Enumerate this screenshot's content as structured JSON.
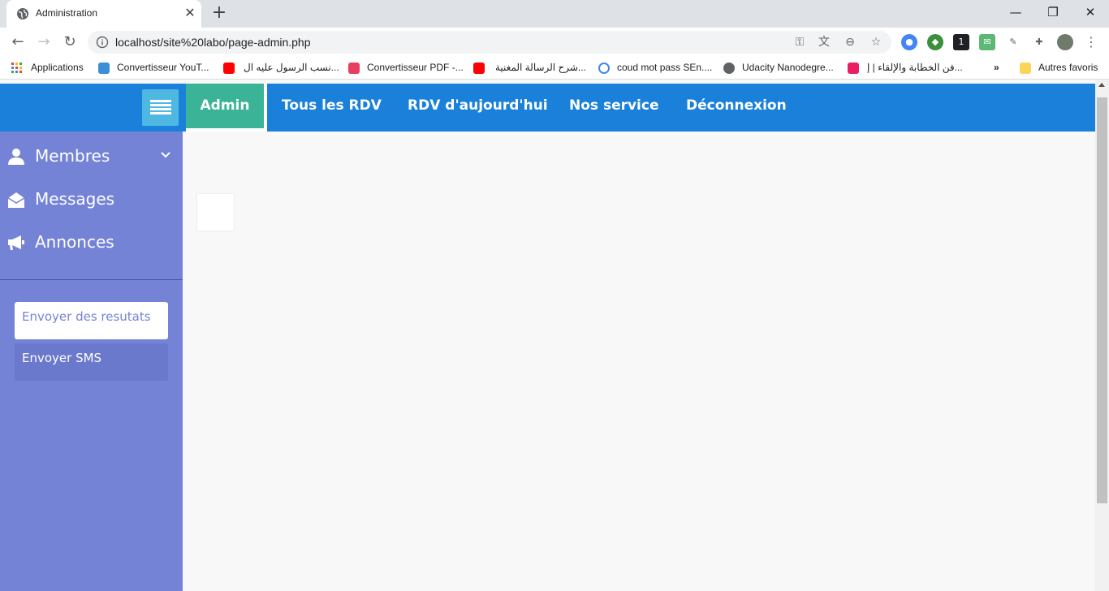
{
  "browser": {
    "tab_title": "Administration",
    "url": "localhost/site%20labo/page-admin.php",
    "bookmarks": [
      {
        "label": "Applications",
        "color": "#ea4335"
      },
      {
        "label": "Convertisseur YouT...",
        "color": "#3b8ed8"
      },
      {
        "label": "نسب الرسول عليه ال...",
        "color": "#ff0000"
      },
      {
        "label": "Convertisseur PDF -...",
        "color": "#e83e5f"
      },
      {
        "label": "شرح الرسالة المغنية...",
        "color": "#ff0000"
      },
      {
        "label": "coud mot pass SEn....",
        "color": "#4285f4"
      },
      {
        "label": "Udacity Nanodegre...",
        "color": "#5f6368"
      },
      {
        "label": "فن الخطابة والإلقاء | إ...",
        "color": "#e91e63"
      }
    ],
    "more_bookmarks": "»",
    "other_bookmarks": "Autres favoris"
  },
  "nav": {
    "items": [
      {
        "label": "Admin",
        "active": true
      },
      {
        "label": "Tous les RDV"
      },
      {
        "label": "RDV d'aujourd'hui"
      },
      {
        "label": "Nos service"
      },
      {
        "label": "Déconnexion"
      }
    ],
    "accent": "#1a80d9",
    "active_color": "#3ab397"
  },
  "sidebar": {
    "items": [
      {
        "label": "Membres",
        "icon": "user-icon"
      },
      {
        "label": "Messages",
        "icon": "envelope-open-icon"
      },
      {
        "label": "Annonces",
        "icon": "megaphone-icon"
      }
    ],
    "actions": [
      {
        "label": "Envoyer des resutats"
      },
      {
        "label": "Envoyer SMS"
      }
    ],
    "background": "#7483d6"
  }
}
